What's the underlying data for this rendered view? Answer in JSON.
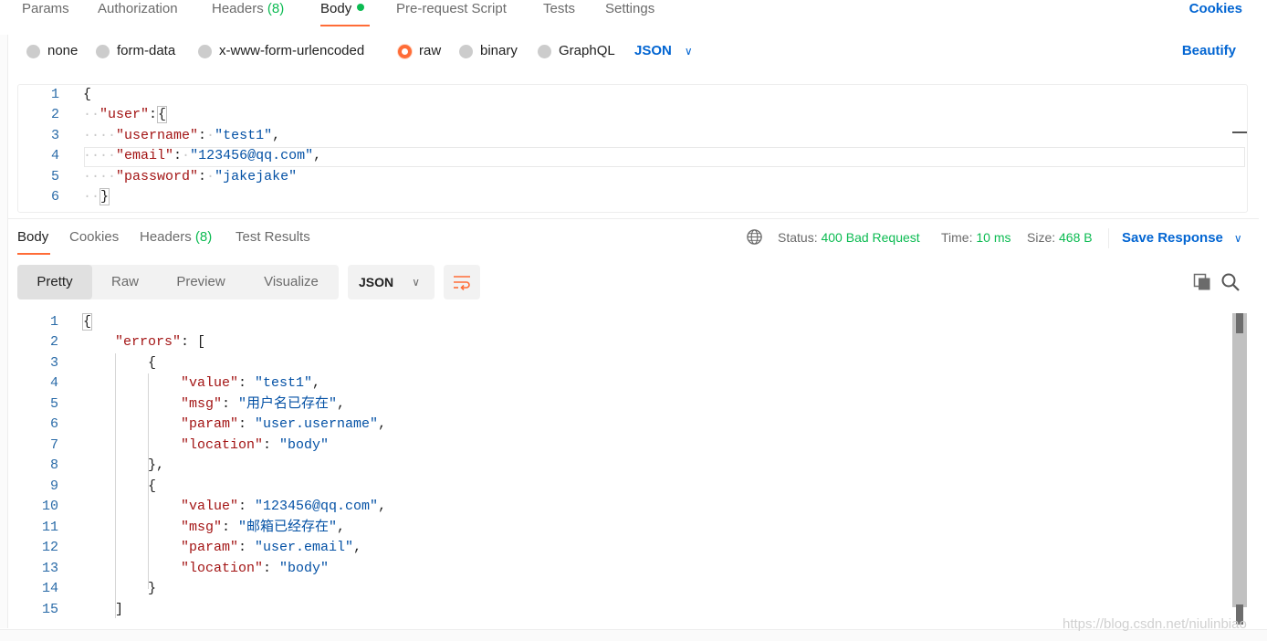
{
  "request_tabs": {
    "params": "Params",
    "authorization": "Authorization",
    "headers": "Headers",
    "headers_count": "(8)",
    "body": "Body",
    "prerequest": "Pre-request Script",
    "tests": "Tests",
    "settings": "Settings",
    "cookies": "Cookies"
  },
  "body_types": {
    "none": "none",
    "form_data": "form-data",
    "urlencoded": "x-www-form-urlencoded",
    "raw": "raw",
    "binary": "binary",
    "graphql": "GraphQL",
    "language": "JSON",
    "beautify": "Beautify"
  },
  "request_body": {
    "line_numbers": [
      "1",
      "2",
      "3",
      "4",
      "5",
      "6"
    ],
    "open_brace": "{",
    "user_key": "\"user\"",
    "username_key": "\"username\"",
    "username_val": "\"test1\"",
    "email_key": "\"email\"",
    "email_val": "\"123456@qq.com\"",
    "password_key": "\"password\"",
    "password_val": "\"jakejake\"",
    "close_brace": "}"
  },
  "response_tabs": {
    "body": "Body",
    "cookies": "Cookies",
    "headers": "Headers",
    "headers_count": "(8)",
    "test_results": "Test Results",
    "status_label": "Status:",
    "status_value": "400 Bad Request",
    "time_label": "Time:",
    "time_value": "10 ms",
    "size_label": "Size:",
    "size_value": "468 B",
    "save_response": "Save Response"
  },
  "response_toolbar": {
    "pretty": "Pretty",
    "raw": "Raw",
    "preview": "Preview",
    "visualize": "Visualize",
    "format": "JSON"
  },
  "response_body": {
    "line_numbers": [
      "1",
      "2",
      "3",
      "4",
      "5",
      "6",
      "7",
      "8",
      "9",
      "10",
      "11",
      "12",
      "13",
      "14",
      "15"
    ],
    "open_brace": "{",
    "errors_key": "\"errors\"",
    "open_bracket": "[",
    "obj_open": "{",
    "value_key": "\"value\"",
    "value1": "\"test1\"",
    "msg_key": "\"msg\"",
    "msg1": "\"用户名已存在\"",
    "param_key": "\"param\"",
    "param1": "\"user.username\"",
    "location_key": "\"location\"",
    "location_val": "\"body\"",
    "obj_close_comma": "},",
    "value2": "\"123456@qq.com\"",
    "msg2": "\"邮箱已经存在\"",
    "param2": "\"user.email\"",
    "obj_close": "}",
    "close_bracket": "]"
  },
  "watermark": "https://blog.csdn.net/niulinbiao",
  "colors": {
    "accent_orange": "#ff6c37",
    "link_blue": "#0265d2",
    "success_green": "#0cbb52",
    "json_key": "#a31515",
    "json_string": "#0451a5"
  }
}
